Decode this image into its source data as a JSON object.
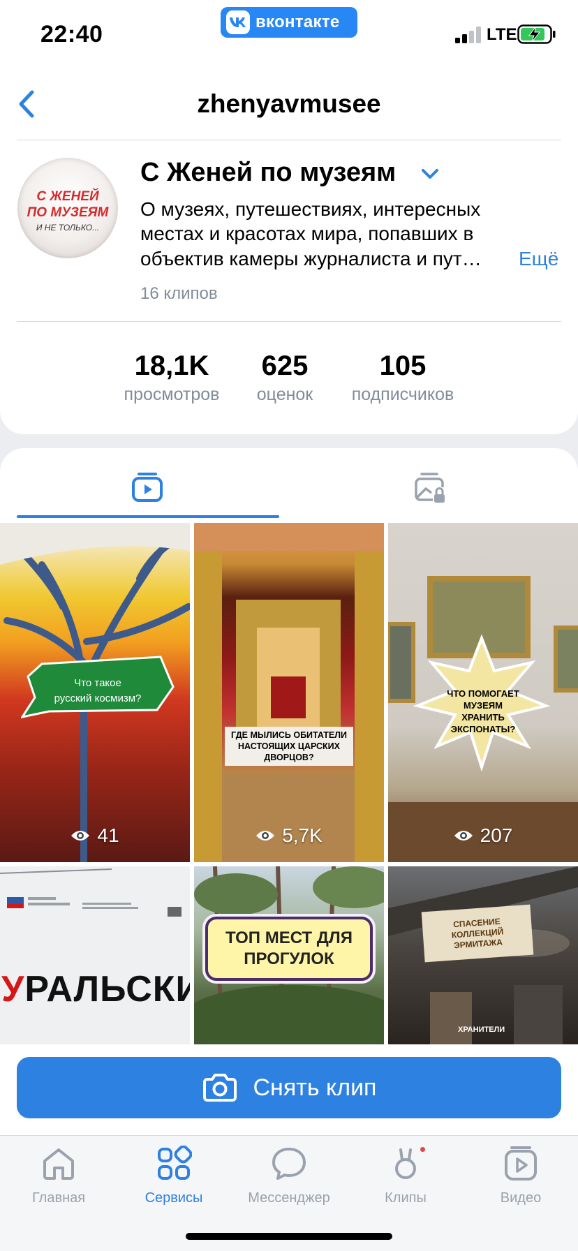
{
  "status_bar": {
    "time": "22:40",
    "app_pill": "вконтакте",
    "network": "LTE"
  },
  "header": {
    "title": "zhenyavmusee"
  },
  "profile": {
    "avatar_lines": [
      "С ЖЕНЕЙ",
      "ПО МУЗЕЯМ",
      "И НЕ ТОЛЬКО..."
    ],
    "name": "С Женей по музеям",
    "description_lines": [
      "О музеях, путешествиях, интересных",
      "местах и красотах мира, попавших в",
      "объектив камеры журналиста и пут…"
    ],
    "more_label": "Ещё",
    "clip_count": "16 клипов"
  },
  "stats": [
    {
      "value": "18,1K",
      "label": "просмотров"
    },
    {
      "value": "625",
      "label": "оценок"
    },
    {
      "value": "105",
      "label": "подписчиков"
    }
  ],
  "tabs": [
    {
      "icon": "clips-play-icon",
      "active": true
    },
    {
      "icon": "private-gallery-lock-icon",
      "active": false
    }
  ],
  "clips": [
    {
      "caption_lines": [
        "Что такое",
        "русский космизм?"
      ],
      "views": "41"
    },
    {
      "caption_lines": [
        "ГДЕ МЫЛИСЬ ОБИТАТЕЛИ",
        "НАСТОЯЩИХ ЦАРСКИХ",
        "ДВОРЦОВ?"
      ],
      "views": "5,7K"
    },
    {
      "caption_lines": [
        "ЧТО ПОМОГАЕТ",
        "МУЗЕЯМ",
        "ХРАНИТЬ",
        "ЭКСПОНАТЫ?"
      ],
      "views": "207"
    },
    {
      "caption_lines": [
        "УРАЛЬСКИЙ"
      ],
      "accent_letter": "У",
      "rest": "РАЛЬСКИЙ"
    },
    {
      "caption_lines": [
        "ТОП МЕСТ ДЛЯ",
        "ПРОГУЛОК"
      ]
    },
    {
      "caption_lines": [
        "СПАСЕНИЕ",
        "КОЛЛЕКЦИЙ",
        "ЭРМИТАЖА"
      ],
      "subtitle": "ХРАНИТЕЛИ"
    }
  ],
  "record_button": {
    "label": "Снять клип"
  },
  "tab_bar": [
    {
      "label": "Главная",
      "icon": "home-icon",
      "active": false
    },
    {
      "label": "Сервисы",
      "icon": "services-grid-icon",
      "active": true
    },
    {
      "label": "Мессенджер",
      "icon": "chat-bubble-icon",
      "active": false
    },
    {
      "label": "Клипы",
      "icon": "clips-bunny-icon",
      "active": false,
      "badge": true
    },
    {
      "label": "Видео",
      "icon": "video-play-icon",
      "active": false
    }
  ],
  "colors": {
    "accent": "#2d81e0",
    "vk_blue": "#2787f5",
    "secondary_text": "#818c99",
    "background": "#ebedf0",
    "badge_red": "#e64646"
  }
}
